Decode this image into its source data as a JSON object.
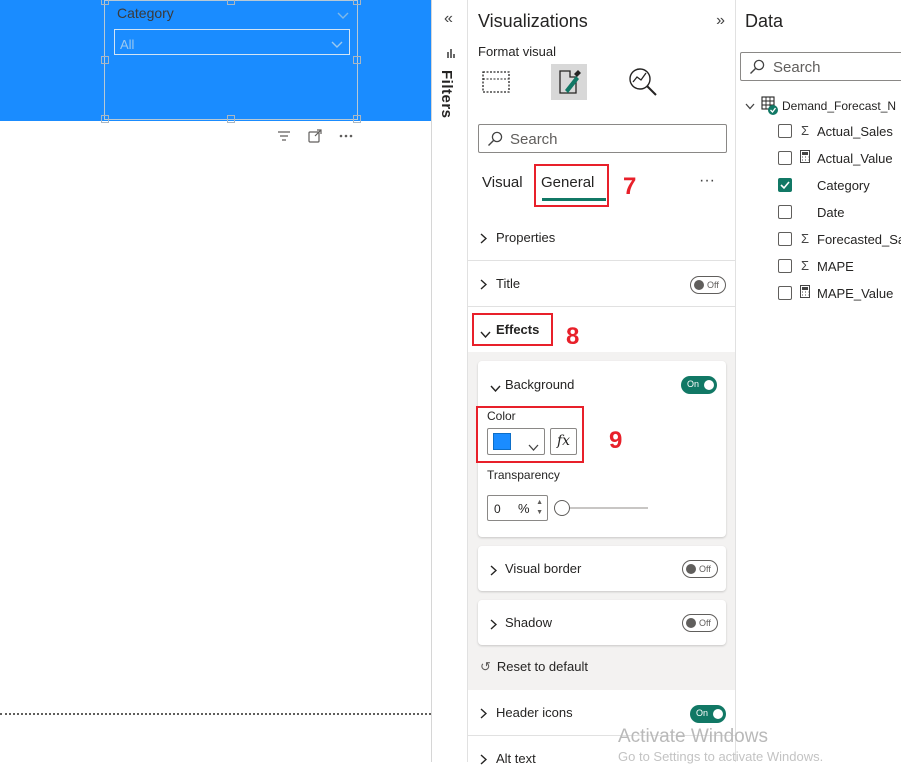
{
  "canvas": {
    "slicer": {
      "header": "Category",
      "dropdown_value": "All"
    }
  },
  "filters": {
    "label": "Filters",
    "collapse_glyph": "«"
  },
  "visualizations": {
    "title": "Visualizations",
    "expand_glyph": "»",
    "format_label": "Format visual",
    "icons": [
      "build-visual-icon",
      "format-visual-icon",
      "analytics-icon"
    ],
    "search_placeholder": "Search",
    "tabs": [
      {
        "label": "Visual",
        "active": false
      },
      {
        "label": "General",
        "active": true
      }
    ],
    "more_glyph": "···",
    "annotations": {
      "general": "7",
      "effects": "8",
      "color": "9"
    },
    "sections": {
      "properties": {
        "label": "Properties"
      },
      "title": {
        "label": "Title",
        "toggle": "Off"
      },
      "effects": {
        "label": "Effects",
        "expanded": true
      },
      "header_icons": {
        "label": "Header icons",
        "toggle": "On"
      },
      "alt_text": {
        "label": "Alt text"
      }
    },
    "effects": {
      "background": {
        "label": "Background",
        "toggle": "On",
        "color_label": "Color",
        "color_value": "#1a8cff",
        "fx_label": "fx",
        "transparency_label": "Transparency",
        "transparency_value": "0",
        "transparency_unit": "%"
      },
      "visual_border": {
        "label": "Visual border",
        "toggle": "Off"
      },
      "shadow": {
        "label": "Shadow",
        "toggle": "Off"
      },
      "reset": "Reset to default"
    }
  },
  "data": {
    "title": "Data",
    "search_placeholder": "Search",
    "table": "Demand_Forecast_N",
    "fields": [
      {
        "name": "Actual_Sales",
        "type": "sum",
        "checked": false
      },
      {
        "name": "Actual_Value",
        "type": "calc",
        "checked": false
      },
      {
        "name": "Category",
        "type": "",
        "checked": true
      },
      {
        "name": "Date",
        "type": "",
        "checked": false
      },
      {
        "name": "Forecasted_Sa",
        "type": "sum",
        "checked": false
      },
      {
        "name": "MAPE",
        "type": "sum",
        "checked": false
      },
      {
        "name": "MAPE_Value",
        "type": "calc",
        "checked": false
      }
    ]
  },
  "watermark": {
    "line1": "Activate Windows",
    "line2": "Go to Settings to activate Windows."
  },
  "colors": {
    "accent": "#117865",
    "canvas_background": "#1a8cff",
    "annotation": "#e8202a"
  }
}
